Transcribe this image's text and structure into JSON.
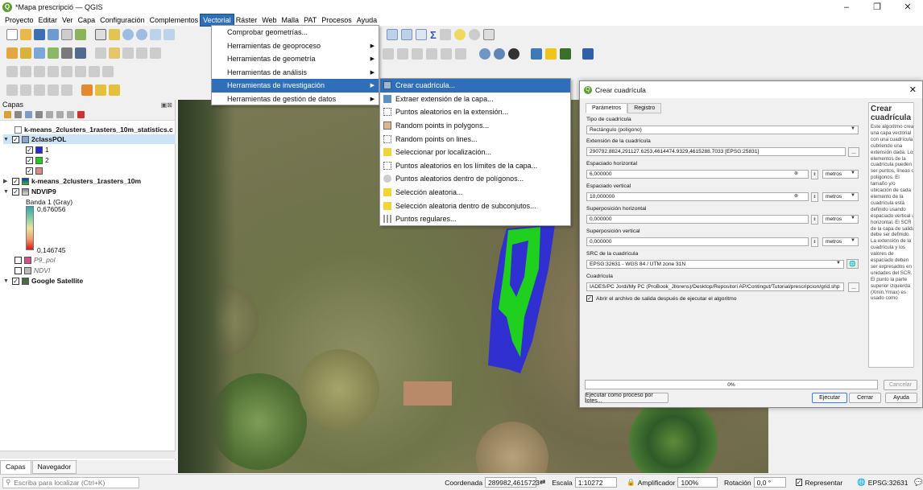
{
  "window": {
    "title": "*Mapa prescripció — QGIS"
  },
  "menubar": [
    "Proyecto",
    "Editar",
    "Ver",
    "Capa",
    "Configuración",
    "Complementos",
    "Vectorial",
    "Ráster",
    "Web",
    "Malla",
    "PAT",
    "Procesos",
    "Ayuda"
  ],
  "vectorial_menu": [
    {
      "label": "Comprobar geometrías...",
      "arrow": ""
    },
    {
      "label": "Herramientas de geoproceso",
      "arrow": "▶"
    },
    {
      "label": "Herramientas de geometría",
      "arrow": "▶"
    },
    {
      "label": "Herramientas de análisis",
      "arrow": "▶"
    },
    {
      "label": "Herramientas de investigación",
      "arrow": "▶"
    },
    {
      "label": "Herramientas de gestión de datos",
      "arrow": "▶"
    }
  ],
  "investigacion_submenu": [
    "Crear cuadrícula...",
    "Extraer extensión de la capa...",
    "Puntos aleatorios en la extensión...",
    "Random points in polygons...",
    "Random points on lines...",
    "Seleccionar por localización...",
    "Puntos aleatorios en los límites de la capa...",
    "Puntos aleatorios dentro de polígonos...",
    "Selección aleatoria...",
    "Selección aleatoria dentro de subconjutos...",
    "Puntos regulares..."
  ],
  "layers_panel": {
    "title": "Capas",
    "items": {
      "l1": "k-means_2clusters_1rasters_10m_statistics.c",
      "l2": "2classPOL",
      "l2a": "1",
      "l2b": "2",
      "l2c": "",
      "l3": "k-means_2clusters_1rasters_10m",
      "l4": "NDVIP9",
      "l4a": "Banda 1 (Gray)",
      "l4max": "0,676056",
      "l4min": "0,146745",
      "l5": "P9_pol",
      "l6": "NDVI",
      "l7": "Google Satellite"
    },
    "colors": {
      "c1": "#2727d6",
      "c2": "#1fcc1f",
      "c3": "#d98b8b",
      "p9": "#d94f8c"
    },
    "tabs": [
      "Capas",
      "Navegador"
    ]
  },
  "dialog": {
    "title": "Crear cuadrícula",
    "tabs": [
      "Parámetros",
      "Registro"
    ],
    "tipo_label": "Tipo de cuadrícula",
    "tipo_value": "Rectángulo (polígono)",
    "ext_label": "Extensión de la cuadrícula",
    "ext_value": "290792.8824,291127.6253,4614474.9329,4615288.7033 [EPSG:25831]",
    "esp_h_label": "Espaciado horizontal",
    "esp_h_value": "6,000000",
    "esp_v_label": "Espaciado vertical",
    "esp_v_value": "10,000000",
    "sup_h_label": "Superposición horizontal",
    "sup_h_value": "0,000000",
    "sup_v_label": "Superposición vertical",
    "sup_v_value": "0,000000",
    "unit": "metros",
    "src_label": "SRC de la cuadrícula",
    "src_value": "EPSG:32631 - WGS 84 / UTM zone 31N",
    "cuad_label": "Cuadrícula",
    "cuad_value": "IADES/PC Jordi/My PC (ProBook_Jllorens)/Desktop/Repositori AP/Contingut/Tutorial/prescripcion/grid.shp",
    "abrir_label": "Abrir el archivo de salida después de ejecutar el algoritmo",
    "help_title": "Crear cuadrícula",
    "help_text": "Este algoritmo crea una capa vectorial con una cuadrícula cubriendo una extensión dada. Los elementos de la cuadrícula pueden ser puntos, líneas o polígonos. El tamaño y/o ubicación de cada elemento de la cuadrícula está definido usando espaciado vertical u horizontal. El SCR de la capa de salida debe ser definido. La extensión de la cuadrícula y los valores de espaciado deben ser expresados en unidades del SCR. El punto la parte superior izquierda (Xmin,Ymax) es usado como",
    "progress": "0%",
    "progress_fraction": 0,
    "cancel": "Cancelar",
    "lotes": "Ejecutar como proceso por lotes...",
    "ejecutar": "Ejecutar",
    "cerrar": "Cerrar",
    "ayuda": "Ayuda",
    "ellipsis": "..."
  },
  "statusbar": {
    "locator_placeholder": "Escriba para localizar (Ctrl+K)",
    "coord_label": "Coordenada",
    "coord_value": "289982,4615723",
    "scale_label": "Escala",
    "scale_value": "1:10272",
    "amp_label": "Amplificador",
    "amp_value": "100%",
    "rot_label": "Rotación",
    "rot_value": "0,0 °",
    "render_label": "Representar",
    "crs": "EPSG:32631"
  }
}
